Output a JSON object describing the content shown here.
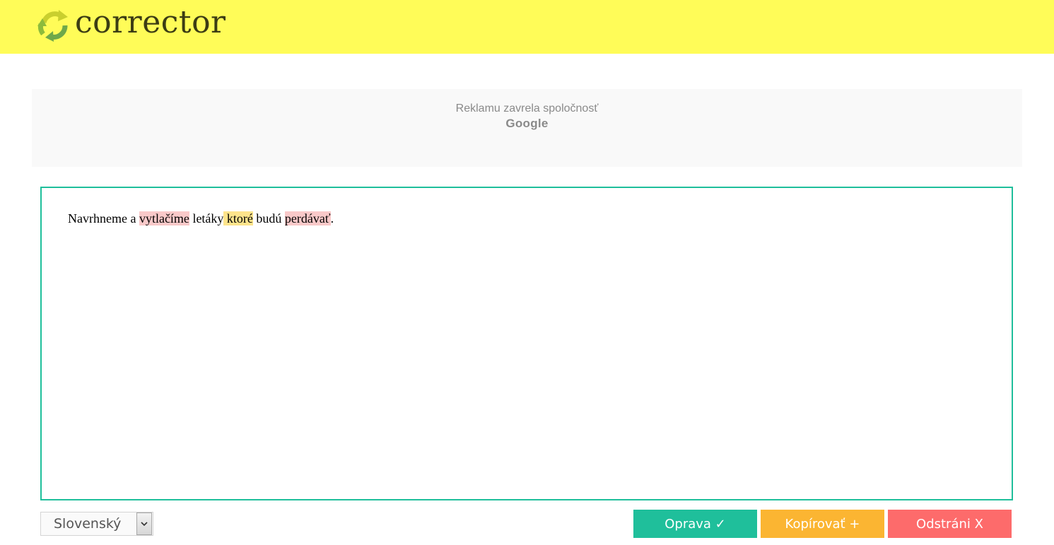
{
  "header": {
    "logo_text": "corrector",
    "logo_icon": "recycle-arrows-icon",
    "background_color": "#fffc58"
  },
  "ad": {
    "closed_text": "Reklamu zavrela spoločnosť",
    "brand": "Google"
  },
  "editor": {
    "border_color": "#1fbf9b",
    "segments": [
      {
        "text": "Navrhneme a ",
        "highlight": "none"
      },
      {
        "text": "vytlačíme",
        "highlight": "spelling-error"
      },
      {
        "text": " letáky",
        "highlight": "none"
      },
      {
        "text": " ktoré",
        "highlight": "grammar-warning"
      },
      {
        "text": " budú ",
        "highlight": "none"
      },
      {
        "text": "perdávať",
        "highlight": "spelling-error"
      },
      {
        "text": ".",
        "highlight": "none"
      }
    ],
    "highlight_colors": {
      "spelling-error": "#f9c9c9",
      "grammar-warning": "#fde48c"
    }
  },
  "controls": {
    "language": {
      "selected": "Slovenský",
      "icon": "chevron-down-icon"
    },
    "buttons": {
      "correct_label": "Oprava ✓",
      "copy_label": "Kopírovať +",
      "remove_label": "Odstráni X"
    },
    "button_colors": {
      "correct": "#1fbf9b",
      "copy": "#fbb532",
      "remove": "#fd6b6b"
    }
  }
}
